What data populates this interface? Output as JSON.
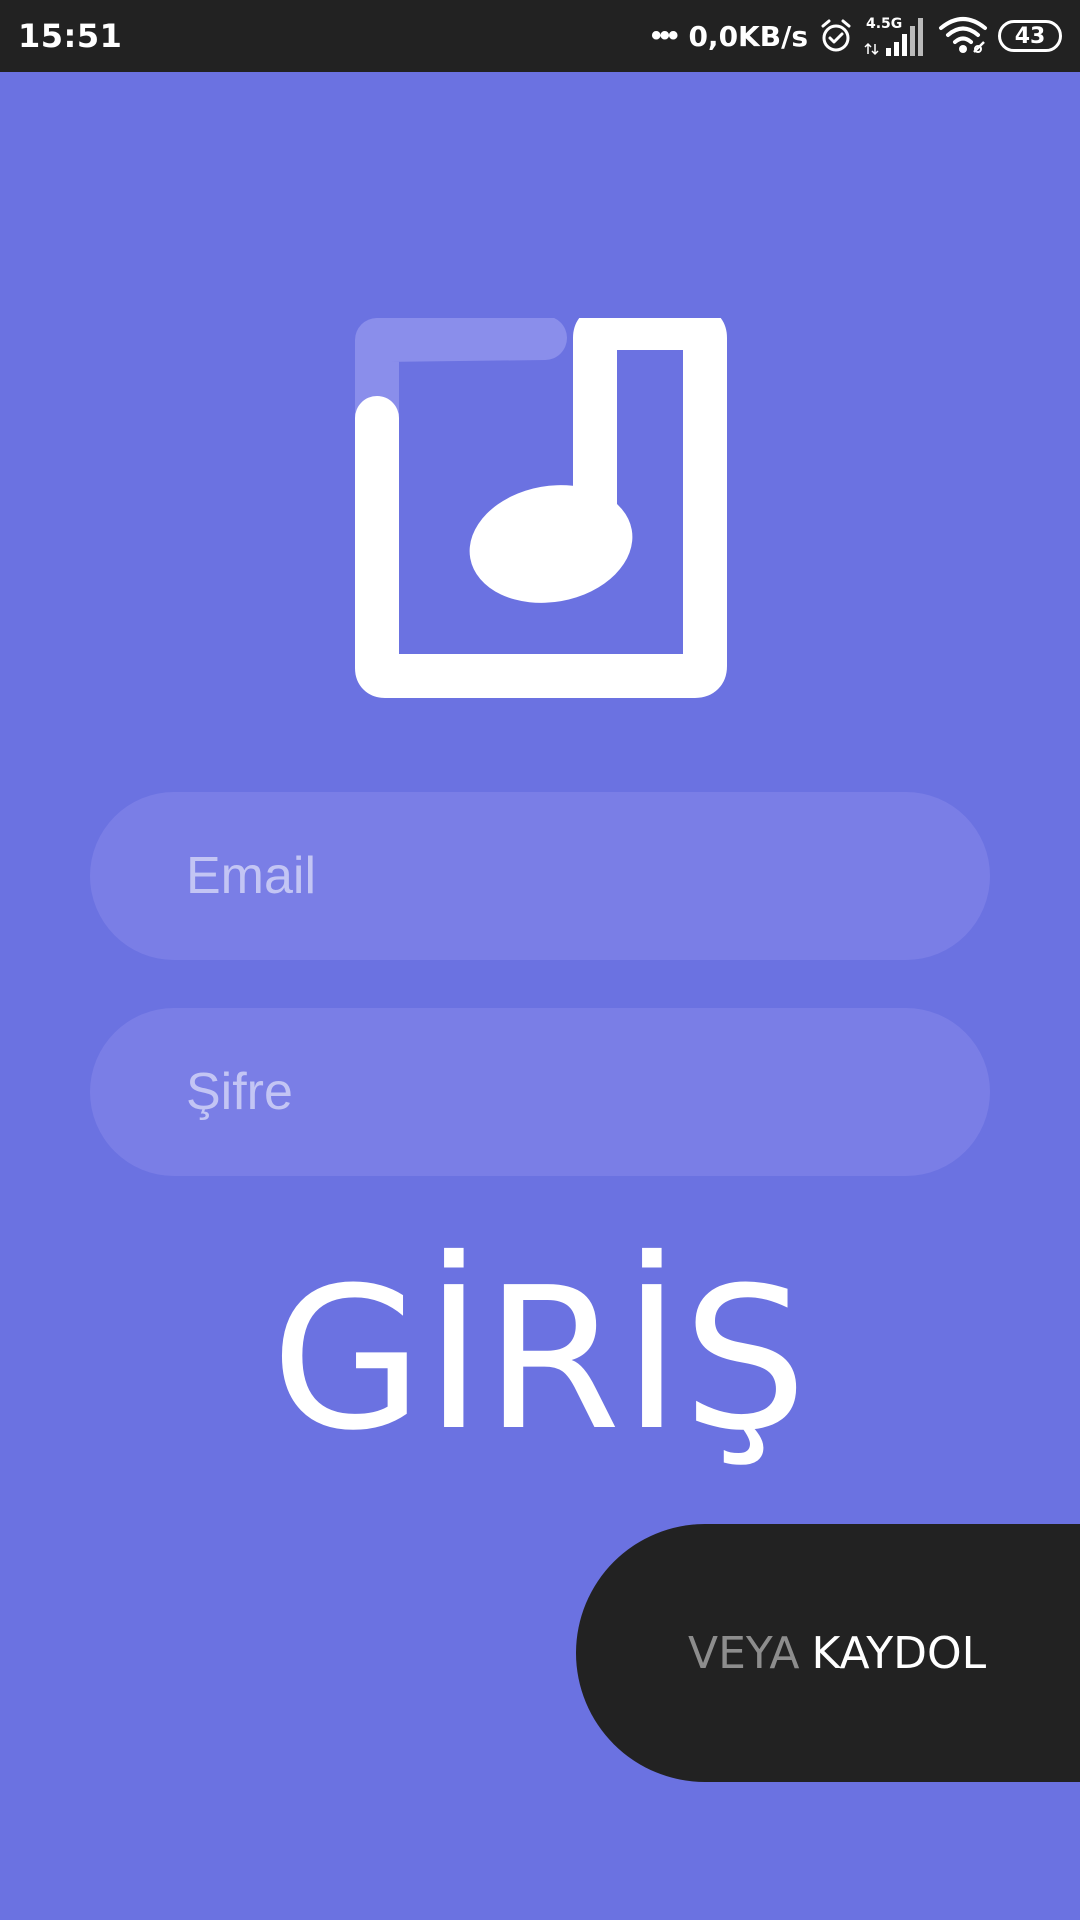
{
  "status_bar": {
    "time": "15:51",
    "dots": "•••",
    "net_speed": "0,0KB/s",
    "network_type": "4.5G",
    "battery": "43",
    "icons": [
      "alarm-icon",
      "cellular-signal-icon",
      "wifi-icon",
      "battery-icon"
    ]
  },
  "logo": {
    "icon": "music-note-app-logo"
  },
  "form": {
    "email_placeholder": "Email",
    "email_value": "",
    "password_placeholder": "Şifre",
    "password_value": ""
  },
  "login": {
    "label": "GİRİŞ"
  },
  "register": {
    "or_label": "VEYA",
    "signup_label": "KAYDOL"
  },
  "colors": {
    "background": "#6b72e1",
    "field_background": "#7a7ee6",
    "status_bar": "#222222",
    "register_pill": "#222222",
    "text_white": "#ffffff",
    "text_muted": "#8d8d8d"
  }
}
